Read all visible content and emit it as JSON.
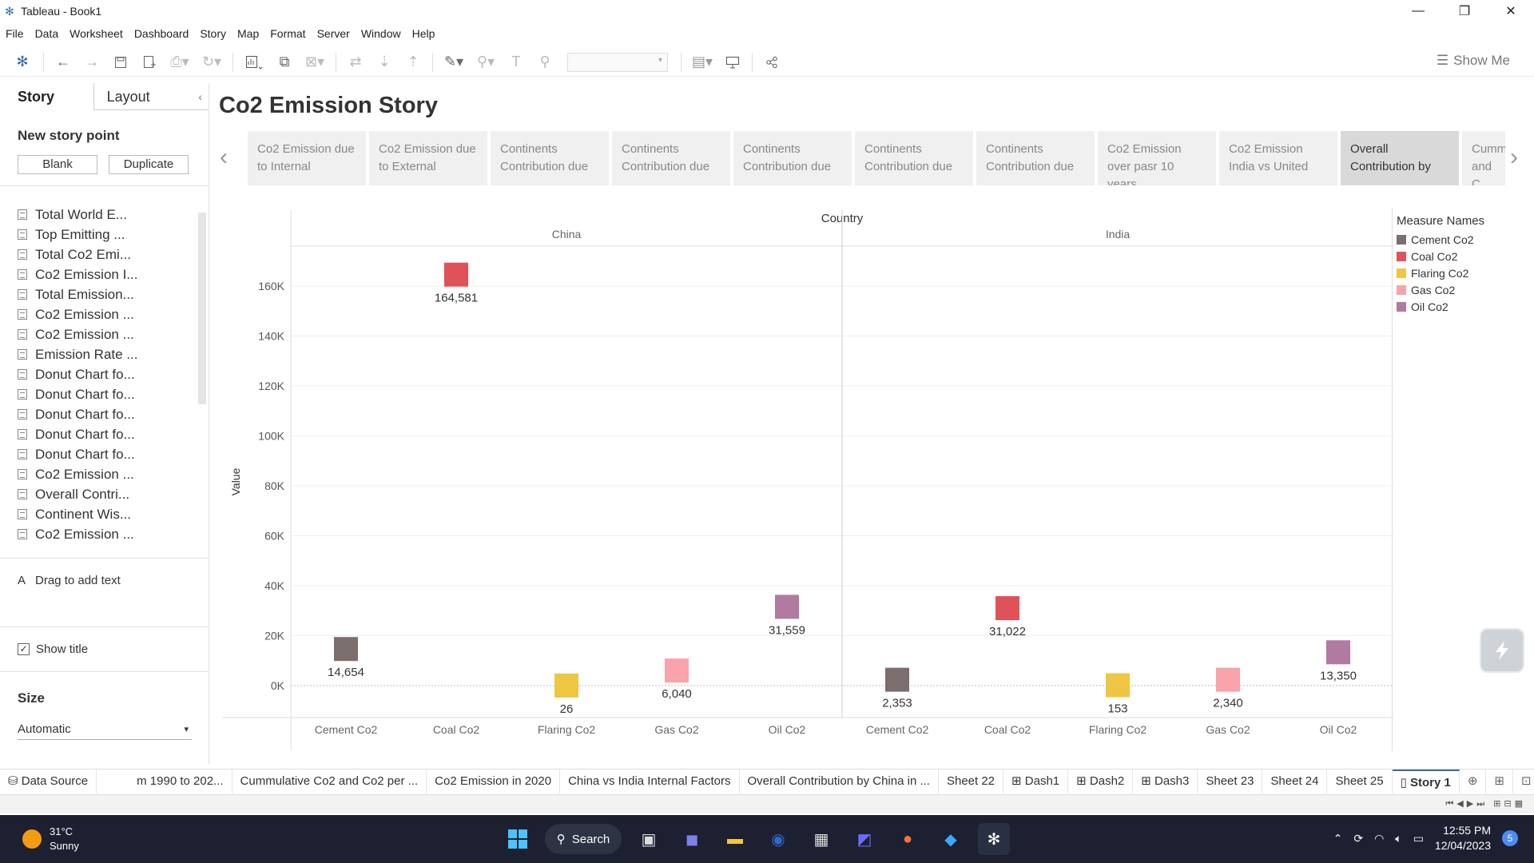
{
  "window": {
    "title": "Tableau - Book1"
  },
  "menu": [
    "File",
    "Data",
    "Worksheet",
    "Dashboard",
    "Story",
    "Map",
    "Format",
    "Server",
    "Window",
    "Help"
  ],
  "toolbar": {
    "show_me": "Show Me"
  },
  "left_pane": {
    "tab_story": "Story",
    "tab_layout": "Layout",
    "new_story_point": "New story point",
    "blank": "Blank",
    "duplicate": "Duplicate",
    "sheets": [
      "Total World E...",
      "Top Emitting ...",
      "Total Co2 Emi...",
      "Co2 Emission I...",
      "Total Emission...",
      "Co2 Emission ...",
      "Co2 Emission  ...",
      "Emission Rate ...",
      "Donut Chart fo...",
      "Donut Chart fo...",
      "Donut Chart fo...",
      "Donut Chart fo...",
      "Donut Chart fo...",
      "Co2 Emission ...",
      "Overall Contri...",
      "Continent Wis...",
      "Co2 Emission ..."
    ],
    "drag_text": "Drag to add text",
    "show_title": "Show title",
    "size_label": "Size",
    "size_value": "Automatic"
  },
  "story": {
    "title": "Co2 Emission Story",
    "points": [
      "Co2 Emission due to Internal",
      "Co2 Emission due to External",
      "Continents Contribution due",
      "Continents Contribution due",
      "Continents Contribution due",
      "Continents Contribution due",
      "Continents Contribution due",
      "Co2 Emission over pasr 10 years",
      "Co2 Emission India vs United",
      "Overall Contribution by",
      "Cumm and C"
    ],
    "active_index": 9
  },
  "legend": {
    "title": "Measure Names",
    "items": [
      {
        "label": "Cement Co2",
        "color": "#7b6e6f"
      },
      {
        "label": "Coal Co2",
        "color": "#e0525a"
      },
      {
        "label": "Flaring Co2",
        "color": "#eec643"
      },
      {
        "label": "Gas Co2",
        "color": "#f9a3ab"
      },
      {
        "label": "Oil Co2",
        "color": "#b07aa1"
      }
    ]
  },
  "chart_data": {
    "type": "scatter",
    "column_header": "Country",
    "panels": [
      "China",
      "India"
    ],
    "categories": [
      "Cement Co2",
      "Coal Co2",
      "Flaring Co2",
      "Gas Co2",
      "Oil Co2"
    ],
    "ylabel": "Value",
    "ylim": [
      0,
      170000
    ],
    "yticks": [
      0,
      20000,
      40000,
      60000,
      80000,
      100000,
      120000,
      140000,
      160000
    ],
    "ytick_labels": [
      "0K",
      "20K",
      "40K",
      "60K",
      "80K",
      "100K",
      "120K",
      "140K",
      "160K"
    ],
    "series": [
      {
        "name": "China",
        "values": [
          14654,
          164581,
          26,
          6040,
          31559
        ],
        "labels": [
          "14,654",
          "164,581",
          "26",
          "6,040",
          "31,559"
        ]
      },
      {
        "name": "India",
        "values": [
          2353,
          31022,
          153,
          2340,
          13350
        ],
        "labels": [
          "2,353",
          "31,022",
          "153",
          "2,340",
          "13,350"
        ]
      }
    ]
  },
  "sheet_tabs": [
    "Data Source",
    "m 1990 to 202...",
    "Cummulative Co2 and Co2 per ...",
    "Co2 Emission in 2020",
    "China vs India Internal Factors",
    "Overall Contribution by China in ...",
    "Sheet 22",
    "Dash1",
    "Dash2",
    "Dash3",
    "Sheet 23",
    "Sheet 24",
    "Sheet 25",
    "Story 1"
  ],
  "taskbar": {
    "temp": "31°C",
    "weather": "Sunny",
    "search": "Search",
    "time": "12:55 PM",
    "date": "12/04/2023",
    "notifications": "5"
  }
}
